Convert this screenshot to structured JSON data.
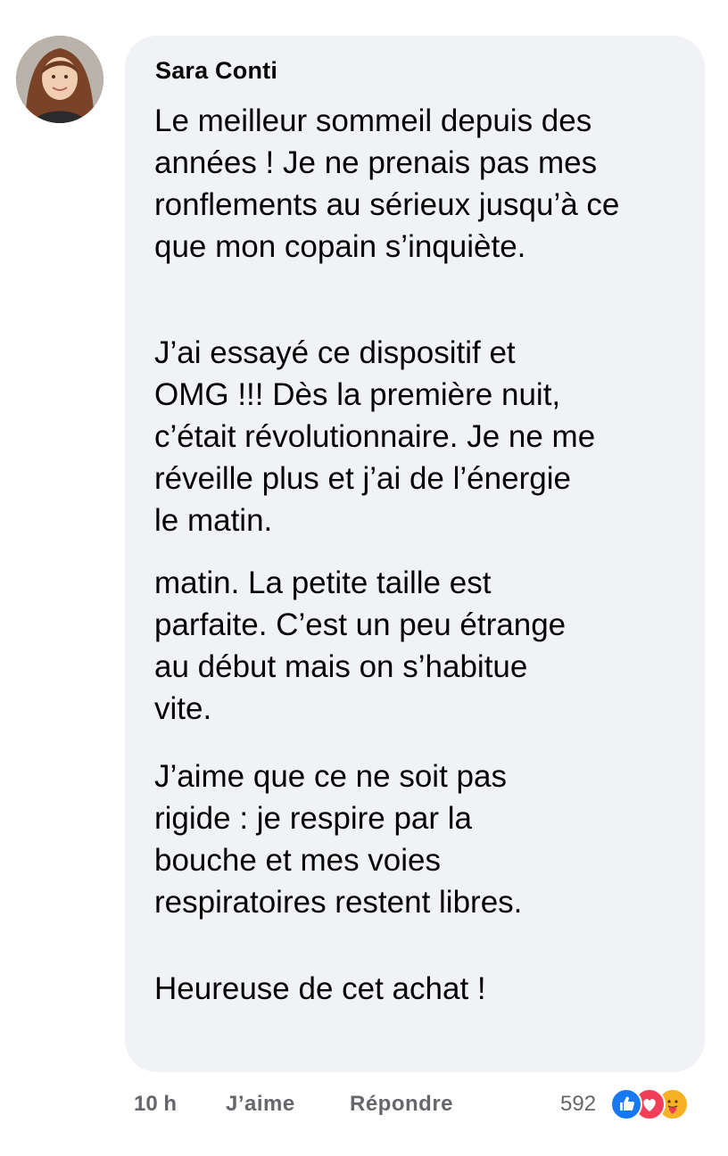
{
  "comment": {
    "author": "Sara Conti",
    "paragraphs": [
      {
        "lines": [
          "Le meilleur sommeil depuis des",
          "années ! Je ne prenais pas mes",
          "ronflements au sérieux jusqu’à ce",
          "que mon copain s’inquiète."
        ]
      },
      {
        "lines": [
          "J’ai essayé ce dispositif et",
          "OMG !!! Dès la première nuit,",
          "c’était révolutionnaire. Je ne me",
          "réveille plus et j’ai de l’énergie",
          "le matin."
        ]
      },
      {
        "lines": [
          "matin. La petite taille est",
          "parfaite. C’est un peu étrange",
          "au début mais on s’habitue",
          "vite."
        ]
      },
      {
        "lines": [
          "J’aime que ce ne soit pas",
          "rigide : je respire par la",
          "bouche et mes voies",
          "respiratoires restent libres."
        ]
      },
      {
        "lines": [
          "Heureuse de cet achat !"
        ]
      }
    ]
  },
  "footer": {
    "time": "10 h",
    "like_label": "J’aime",
    "reply_label": "Répondre",
    "reaction_count": "592",
    "reaction_icons": [
      "like-icon",
      "love-icon",
      "care-icon"
    ]
  },
  "colors": {
    "bubble": "#f0f2f5",
    "meta_text": "#65676b",
    "like": "#1877f2",
    "love": "#f33e58",
    "care": "#f7b125"
  }
}
